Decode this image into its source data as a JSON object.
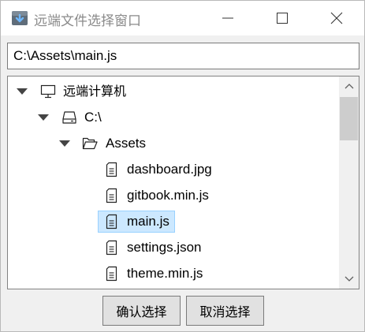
{
  "window": {
    "title": "远端文件选择窗口"
  },
  "path": {
    "value": "C:\\Assets\\main.js"
  },
  "tree": {
    "root": {
      "label": "远端计算机",
      "icon": "monitor-icon"
    },
    "drive": {
      "label": "C:\\",
      "icon": "drive-icon"
    },
    "folder": {
      "label": "Assets",
      "icon": "folder-open-icon"
    },
    "files": [
      {
        "label": "dashboard.jpg",
        "icon": "file-icon"
      },
      {
        "label": "gitbook.min.js",
        "icon": "file-icon"
      },
      {
        "label": "main.js",
        "icon": "file-icon",
        "selected": true
      },
      {
        "label": "settings.json",
        "icon": "file-icon"
      },
      {
        "label": "theme.min.js",
        "icon": "file-icon"
      }
    ],
    "selection_color": "#cce8ff"
  },
  "buttons": {
    "confirm": "确认选择",
    "cancel": "取消选择"
  }
}
